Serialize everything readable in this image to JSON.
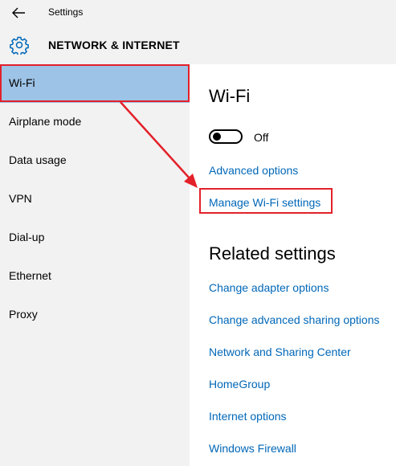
{
  "window": {
    "title": "Settings"
  },
  "header": {
    "title": "NETWORK & INTERNET"
  },
  "sidebar": {
    "items": [
      {
        "label": "Wi-Fi",
        "selected": true
      },
      {
        "label": "Airplane mode"
      },
      {
        "label": "Data usage"
      },
      {
        "label": "VPN"
      },
      {
        "label": "Dial-up"
      },
      {
        "label": "Ethernet"
      },
      {
        "label": "Proxy"
      }
    ]
  },
  "content": {
    "title": "Wi-Fi",
    "toggle": {
      "state_label": "Off",
      "on": false
    },
    "links": {
      "advanced_options": "Advanced options",
      "manage_wifi": "Manage Wi-Fi settings"
    },
    "related": {
      "title": "Related settings",
      "links": [
        "Change adapter options",
        "Change advanced sharing options",
        "Network and Sharing Center",
        "HomeGroup",
        "Internet options",
        "Windows Firewall"
      ]
    }
  },
  "colors": {
    "accent_link": "#0067b8",
    "selection": "#9dc3e6",
    "annotation_red": "#e3212a",
    "sidebar_bg": "#f2f2f2"
  },
  "icons": {
    "back": "back-arrow-icon",
    "settings": "gear-icon"
  }
}
